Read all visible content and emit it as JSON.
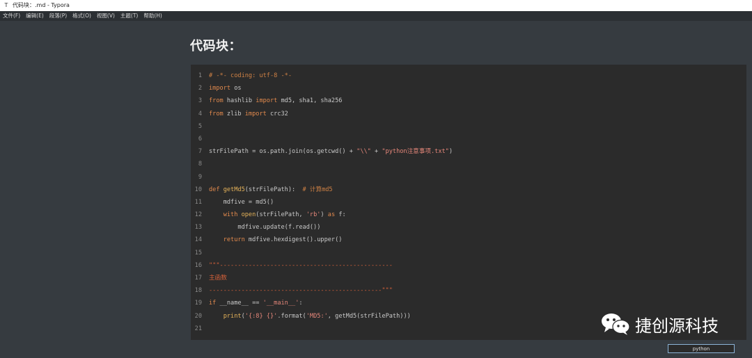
{
  "window": {
    "title": "代码块：.md - Typora",
    "app_icon": "T"
  },
  "menu": [
    "文件(F)",
    "编辑(E)",
    "段落(P)",
    "格式(O)",
    "视图(V)",
    "主题(T)",
    "帮助(H)"
  ],
  "document": {
    "heading": "代码块："
  },
  "code_block": {
    "language": "python",
    "line_numbers": [
      "1",
      "2",
      "3",
      "4",
      "5",
      "6",
      "7",
      "8",
      "9",
      "10",
      "11",
      "12",
      "13",
      "14",
      "15",
      "16",
      "17",
      "18",
      "19",
      "20",
      "21"
    ],
    "lines": [
      "# -*- coding: utf-8 -*-",
      "import os",
      "from hashlib import md5, sha1, sha256",
      "from zlib import crc32",
      "",
      "",
      "strFilePath = os.path.join(os.getcwd() + \"\\\\\" + \"python注意事项.txt\")",
      "",
      "",
      "def getMd5(strFilePath):  # 计算md5",
      "    mdfive = md5()",
      "    with open(strFilePath, 'rb') as f:",
      "        mdfive.update(f.read())",
      "    return mdfive.hexdigest().upper()",
      "",
      "\"\"\"------------------------------------------------",
      "主函数",
      "------------------------------------------------\"\"\"",
      "if __name__ == '__main__':",
      "    print('{:8} {}'.format('MD5:', getMd5(strFilePath)))",
      ""
    ],
    "segments": {
      "l1": "# -*- coding: utf-8 -*-",
      "l2_kw": "import",
      "l2_rest": " os",
      "l3_kw1": "from",
      "l3_mod": " hashlib ",
      "l3_kw2": "import",
      "l3_rest": " md5, sha1, sha256",
      "l4_kw1": "from",
      "l4_mod": " zlib ",
      "l4_kw2": "import",
      "l4_rest": " crc32",
      "l7_a": "strFilePath = os.path.join(os.getcwd() + ",
      "l7_s1": "\"\\\\\"",
      "l7_b": " + ",
      "l7_s2": "\"python注意事项.txt\"",
      "l7_c": ")",
      "l10_kw": "def",
      "l10_fn": " getMd5",
      "l10_rest": "(strFilePath):  ",
      "l10_com": "# 计算md5",
      "l11": "    mdfive = md5()",
      "l12_ind": "    ",
      "l12_kw": "with",
      "l12_fn": " open",
      "l12_a": "(strFilePath, ",
      "l12_s": "'rb'",
      "l12_b": ") ",
      "l12_kw2": "as",
      "l12_c": " f:",
      "l13": "        mdfive.update(f.read())",
      "l14_ind": "    ",
      "l14_kw": "return",
      "l14_rest": " mdfive.hexdigest().upper()",
      "l16": "\"\"\"------------------------------------------------",
      "l17": "主函数",
      "l18": "------------------------------------------------\"\"\"",
      "l19_kw": "if",
      "l19_a": " __name__ == ",
      "l19_s": "'__main__'",
      "l19_b": ":",
      "l20_ind": "    ",
      "l20_fn": "print",
      "l20_a": "(",
      "l20_s1": "'{:8} {}'",
      "l20_b": ".format(",
      "l20_s2": "'MD5:'",
      "l20_c": ", getMd5(strFilePath)))"
    }
  },
  "watermark": {
    "text": "捷创源科技",
    "icon": "wechat-icon"
  },
  "colors": {
    "background": "#363b40",
    "code_background": "#2b2b2b",
    "keyword": "#e38a4d",
    "string": "#e6877a"
  }
}
